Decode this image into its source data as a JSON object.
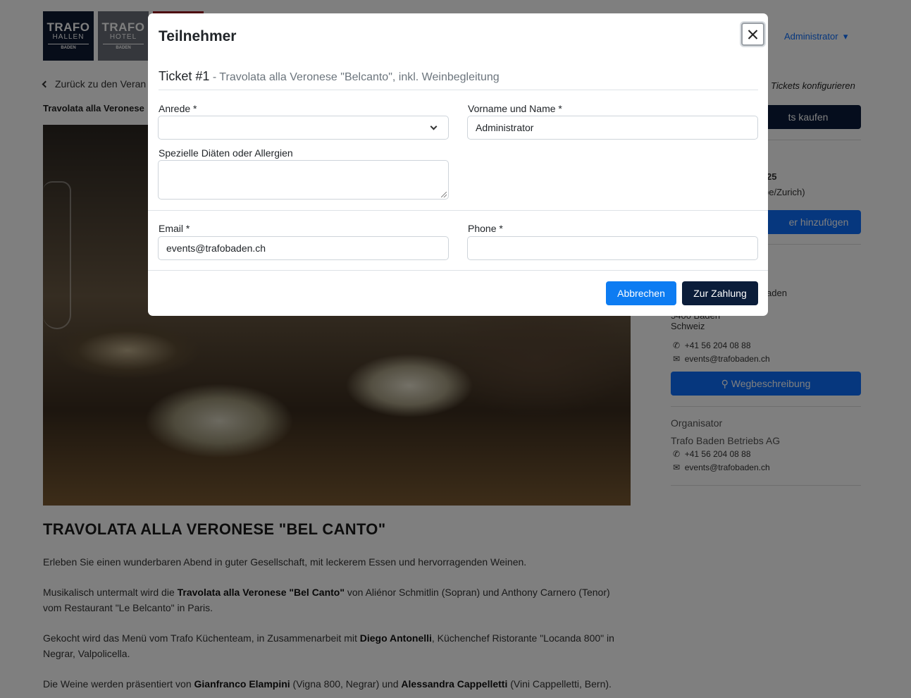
{
  "header": {
    "logos": [
      {
        "line1": "TRAFO",
        "line2": "HALLEN",
        "line3": "BADEN"
      },
      {
        "line1": "TRAFO",
        "line2": "HOTEL",
        "line3": "BADEN"
      }
    ],
    "user_menu": "Administrator"
  },
  "page": {
    "back_link": "Zurück zu den Veran",
    "breadcrumb": "Travolata alla Veronese",
    "configure_link": "Tickets konfigurieren",
    "article_title": "TRAVOLATA ALLA VERONESE \"BEL CANTO\"",
    "p1": "Erleben Sie einen wunderbaren Abend in guter Gesellschaft, mit leckerem Essen und hervorragenden Weinen.",
    "p2_a": "Musikalisch untermalt wird die ",
    "p2_b": "Travolata alla Veronese \"Bel Canto\"",
    "p2_c": " von Aliénor Schmitlin (Sopran) und Anthony Carnero (Tenor) vom Restaurant \"Le Belcanto\" in Paris.",
    "p3_a": "Gekocht wird das Menü vom Trafo Küchenteam, in Zusammenarbeit mit ",
    "p3_b": "Diego Antonelli",
    "p3_c": ", Küchenchef Ristorante \"Locanda 800\" in Negrar, Valpolicella.",
    "p4_a": "Die Weine werden präsentiert von ",
    "p4_b": "Gianfranco Elampini",
    "p4_c": " (Vigna 800, Negrar) und ",
    "p4_d": "Alessandra Cappelletti",
    "p4_e": " (Vini Cappelletti, Bern)."
  },
  "sidebar": {
    "buy_button": "ts kaufen",
    "date_fragment": "25",
    "timezone_fragment": "pe/Zurich)",
    "calendar_button": "er hinzufügen",
    "venue_city_fragment": "aden",
    "venue_zip_fragment": "5400 Baden",
    "venue_country": "Schweiz",
    "venue_phone": "+41 56 204 08 88",
    "venue_email": "events@trafobaden.ch",
    "directions_button": "Wegbeschreibung",
    "organizer_heading": "Organisator",
    "organizer_name": "Trafo Baden Betriebs AG",
    "organizer_phone": "+41 56 204 08 88",
    "organizer_email": "events@trafobaden.ch"
  },
  "modal": {
    "title": "Teilnehmer",
    "ticket_label": "Ticket #1",
    "ticket_desc": " - Travolata alla Veronese \"Belcanto\", inkl. Weinbegleitung",
    "salutation_label": "Anrede *",
    "salutation_value": "",
    "name_label": "Vorname und Name *",
    "name_value": "Administrator",
    "diet_label": "Spezielle Diäten oder Allergien",
    "diet_value": "",
    "email_label": "Email *",
    "email_value": "events@trafobaden.ch",
    "phone_label": "Phone *",
    "phone_value": "",
    "cancel_button": "Abbrechen",
    "pay_button": "Zur Zahlung"
  },
  "colors": {
    "primary": "#0d7cf2",
    "dark_navy": "#0b1d3a",
    "backdrop": "rgba(0,0,0,0.5)"
  }
}
